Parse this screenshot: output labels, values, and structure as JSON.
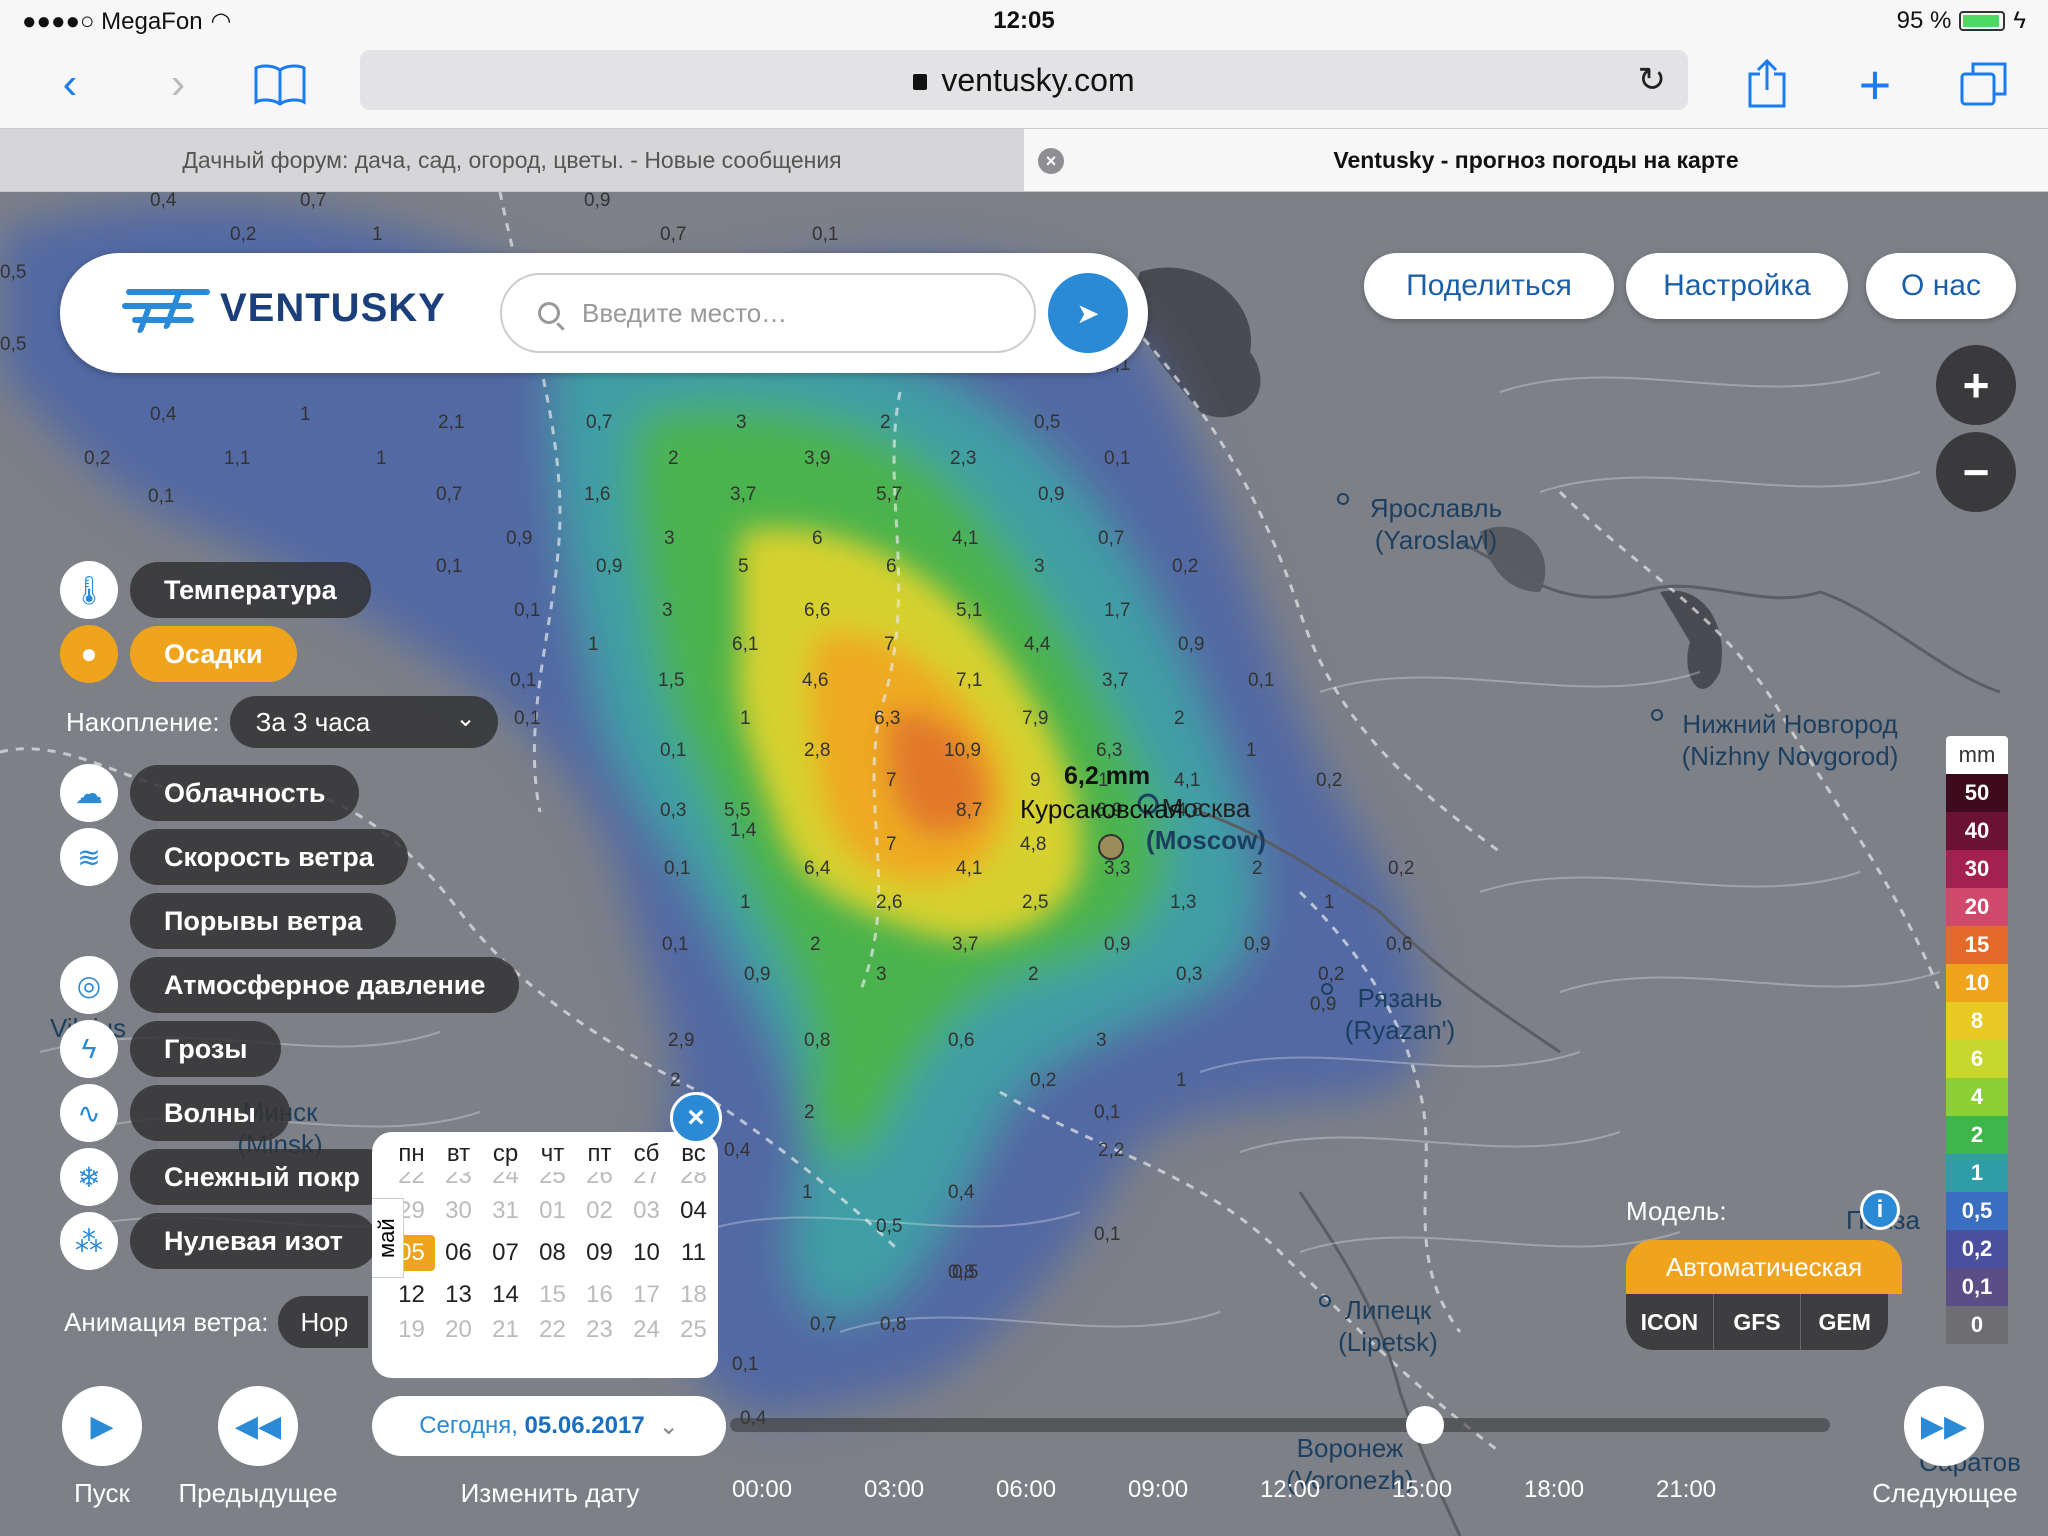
{
  "status": {
    "carrier": "●●●●○ MegaFon",
    "time": "12:05",
    "battery": "95 %"
  },
  "browser": {
    "url": "ventusky.com"
  },
  "tabs": [
    {
      "title": "Дачный форум: дача, сад, огород, цветы. - Новые сообщения"
    },
    {
      "title": "Ventusky - прогноз погоды на карте"
    }
  ],
  "brand": {
    "name": "VENTUSKY"
  },
  "search": {
    "placeholder": "Введите место…"
  },
  "top_buttons": {
    "share": "Поделиться",
    "settings": "Настройка",
    "about": "О нас"
  },
  "zoom": {
    "in": "+",
    "out": "−"
  },
  "layers": [
    {
      "label": "Температура",
      "icon": "thermometer-icon"
    },
    {
      "label": "Осадки",
      "icon": "drop-icon",
      "selected": true
    },
    {
      "label": "Облачность",
      "icon": "cloud-icon"
    },
    {
      "label": "Скорость ветра",
      "icon": "wind-icon"
    },
    {
      "label": "Порывы ветра"
    },
    {
      "label": "Атмосферное давление",
      "icon": "pressure-icon"
    },
    {
      "label": "Грозы",
      "icon": "lightning-icon"
    },
    {
      "label": "Волны",
      "icon": "waves-icon"
    },
    {
      "label": "Снежный покр",
      "icon": "snowflake-icon"
    },
    {
      "label": "Нулевая изот",
      "icon": "freezing-icon"
    }
  ],
  "accumulation": {
    "label": "Накопление:",
    "value": "За 3 часа"
  },
  "wind_animation": {
    "label": "Анимация ветра:",
    "value": "Нор"
  },
  "calendar": {
    "month": "май",
    "days_header": [
      "пн",
      "вт",
      "ср",
      "чт",
      "пт",
      "сб",
      "вс"
    ],
    "rows": [
      [
        "22",
        "23",
        "24",
        "25",
        "26",
        "27",
        "28"
      ],
      [
        "29",
        "30",
        "31",
        "01",
        "02",
        "03",
        "04"
      ],
      [
        "05",
        "06",
        "07",
        "08",
        "09",
        "10",
        "11"
      ],
      [
        "12",
        "13",
        "14",
        "15",
        "16",
        "17",
        "18"
      ],
      [
        "19",
        "20",
        "21",
        "22",
        "23",
        "24",
        "25"
      ]
    ],
    "selected": "05"
  },
  "date_button": {
    "prefix": "Сегодня,",
    "date": "05.06.2017"
  },
  "controls": {
    "play": "Пуск",
    "previous": "Предыдущее",
    "change_date": "Изменить дату",
    "next": "Следующее"
  },
  "timeline": {
    "ticks": [
      "00:00",
      "03:00",
      "06:00",
      "09:00",
      "12:00",
      "15:00",
      "18:00",
      "21:00"
    ],
    "position": "14:00"
  },
  "legend": {
    "unit": "mm",
    "values": [
      "50",
      "40",
      "30",
      "20",
      "15",
      "10",
      "8",
      "6",
      "4",
      "2",
      "1",
      "0,5",
      "0,2",
      "0,1",
      "0"
    ],
    "colors": [
      "#3d0b1c",
      "#6b1234",
      "#a4204f",
      "#d0486a",
      "#e46a2c",
      "#f0a41e",
      "#e9c923",
      "#c8d72d",
      "#8ccf34",
      "#3fb64a",
      "#2e9da5",
      "#3a6ec0",
      "#4b4fa0",
      "#5b4e86",
      "#6e6e72"
    ]
  },
  "model": {
    "label": "Модель:",
    "auto": "Автоматическая",
    "options": [
      "ICON",
      "GFS",
      "GEM"
    ]
  },
  "marker": {
    "value": "6,2 mm",
    "place": "Курсаковская"
  },
  "cities": [
    {
      "name": "Ярославль",
      "latin": "(Yaroslavl)"
    },
    {
      "name": "Нижний Новгород",
      "latin": "(Nizhny Novgorod)"
    },
    {
      "name": "Москва",
      "latin": "(Moscow)"
    },
    {
      "name": "Рязань",
      "latin": "(Ryazan')"
    },
    {
      "name": "Липецк",
      "latin": "(Lipetsk)"
    },
    {
      "name": "Воронеж",
      "latin": "(Voronezh)"
    },
    {
      "name": "Минск",
      "latin": "(Minsk)"
    },
    {
      "name": "Vilnius",
      "latin": ""
    },
    {
      "name": "Пенза",
      "latin": ""
    },
    {
      "name": "Саратов",
      "latin": ""
    }
  ],
  "grid_values": [
    {
      "v": "0,4"
    },
    {
      "v": "0,7"
    },
    {
      "v": "0,9"
    },
    {
      "v": "0,7"
    },
    {
      "v": "0,1"
    },
    {
      "v": "0,2"
    },
    {
      "v": "1"
    },
    {
      "v": "0,5"
    },
    {
      "v": "0,5"
    },
    {
      "v": "0,9"
    },
    {
      "v": "0,8"
    },
    {
      "v": "2"
    },
    {
      "v": "2"
    },
    {
      "v": "0,1"
    },
    {
      "v": "0,4"
    },
    {
      "v": "1"
    },
    {
      "v": "2,1"
    },
    {
      "v": "0,7"
    },
    {
      "v": "3"
    },
    {
      "v": "2"
    },
    {
      "v": "0,5"
    },
    {
      "v": "0,2"
    },
    {
      "v": "1,1"
    },
    {
      "v": "1"
    },
    {
      "v": "2"
    },
    {
      "v": "3,9"
    },
    {
      "v": "2,3"
    },
    {
      "v": "0,1"
    },
    {
      "v": "0,1"
    },
    {
      "v": "0,7"
    },
    {
      "v": "1,6"
    },
    {
      "v": "3,7"
    },
    {
      "v": "5,7"
    },
    {
      "v": "0,9"
    },
    {
      "v": "0,9"
    },
    {
      "v": "3"
    },
    {
      "v": "6"
    },
    {
      "v": "4,1"
    },
    {
      "v": "0,7"
    },
    {
      "v": "0,1"
    },
    {
      "v": "0,9"
    },
    {
      "v": "5"
    },
    {
      "v": "6"
    },
    {
      "v": "3"
    },
    {
      "v": "0,2"
    },
    {
      "v": "0,1"
    },
    {
      "v": "3"
    },
    {
      "v": "6,6"
    },
    {
      "v": "5,1"
    },
    {
      "v": "1,7"
    },
    {
      "v": "1"
    },
    {
      "v": "6,1"
    },
    {
      "v": "7"
    },
    {
      "v": "4,4"
    },
    {
      "v": "0,9"
    },
    {
      "v": "0,1"
    },
    {
      "v": "1,5"
    },
    {
      "v": "4,6"
    },
    {
      "v": "7,1"
    },
    {
      "v": "3,7"
    },
    {
      "v": "0,1"
    },
    {
      "v": "0,1"
    },
    {
      "v": "1"
    },
    {
      "v": "6,3"
    },
    {
      "v": "7,9"
    },
    {
      "v": "2"
    },
    {
      "v": "0,1"
    },
    {
      "v": "2,8"
    },
    {
      "v": "10,9"
    },
    {
      "v": "6,3"
    },
    {
      "v": "1"
    },
    {
      "v": "1"
    },
    {
      "v": "7"
    },
    {
      "v": "9"
    },
    {
      "v": "4,1"
    },
    {
      "v": "0,2"
    },
    {
      "v": "0,3"
    },
    {
      "v": "5,5"
    },
    {
      "v": "8,7"
    },
    {
      "v": "6,9"
    },
    {
      "v": "4,8"
    },
    {
      "v": "1,4"
    },
    {
      "v": "7"
    },
    {
      "v": "4,8"
    },
    {
      "v": "0,1"
    },
    {
      "v": "6,4"
    },
    {
      "v": "4,1"
    },
    {
      "v": "3,3"
    },
    {
      "v": "2"
    },
    {
      "v": "0,2"
    },
    {
      "v": "1"
    },
    {
      "v": "2,6"
    },
    {
      "v": "2,5"
    },
    {
      "v": "1,3"
    },
    {
      "v": "1"
    },
    {
      "v": "0,1"
    },
    {
      "v": "2"
    },
    {
      "v": "3,7"
    },
    {
      "v": "0,9"
    },
    {
      "v": "0,9"
    },
    {
      "v": "0,6"
    },
    {
      "v": "0,9"
    },
    {
      "v": "3"
    },
    {
      "v": "2"
    },
    {
      "v": "0,3"
    },
    {
      "v": "0,2"
    },
    {
      "v": "0,9"
    },
    {
      "v": "2,9"
    },
    {
      "v": "0,8"
    },
    {
      "v": "0,6"
    },
    {
      "v": "3"
    },
    {
      "v": "2"
    },
    {
      "v": "0,2"
    },
    {
      "v": "1"
    },
    {
      "v": "2"
    },
    {
      "v": "0,1"
    },
    {
      "v": "0,4"
    },
    {
      "v": "1"
    },
    {
      "v": "0,4"
    },
    {
      "v": "2,2"
    },
    {
      "v": "0,5"
    },
    {
      "v": "0,8"
    },
    {
      "v": "0,1"
    },
    {
      "v": "0,5"
    },
    {
      "v": "0,8"
    },
    {
      "v": "0,7"
    },
    {
      "v": "0,1"
    },
    {
      "v": "0,4"
    }
  ]
}
